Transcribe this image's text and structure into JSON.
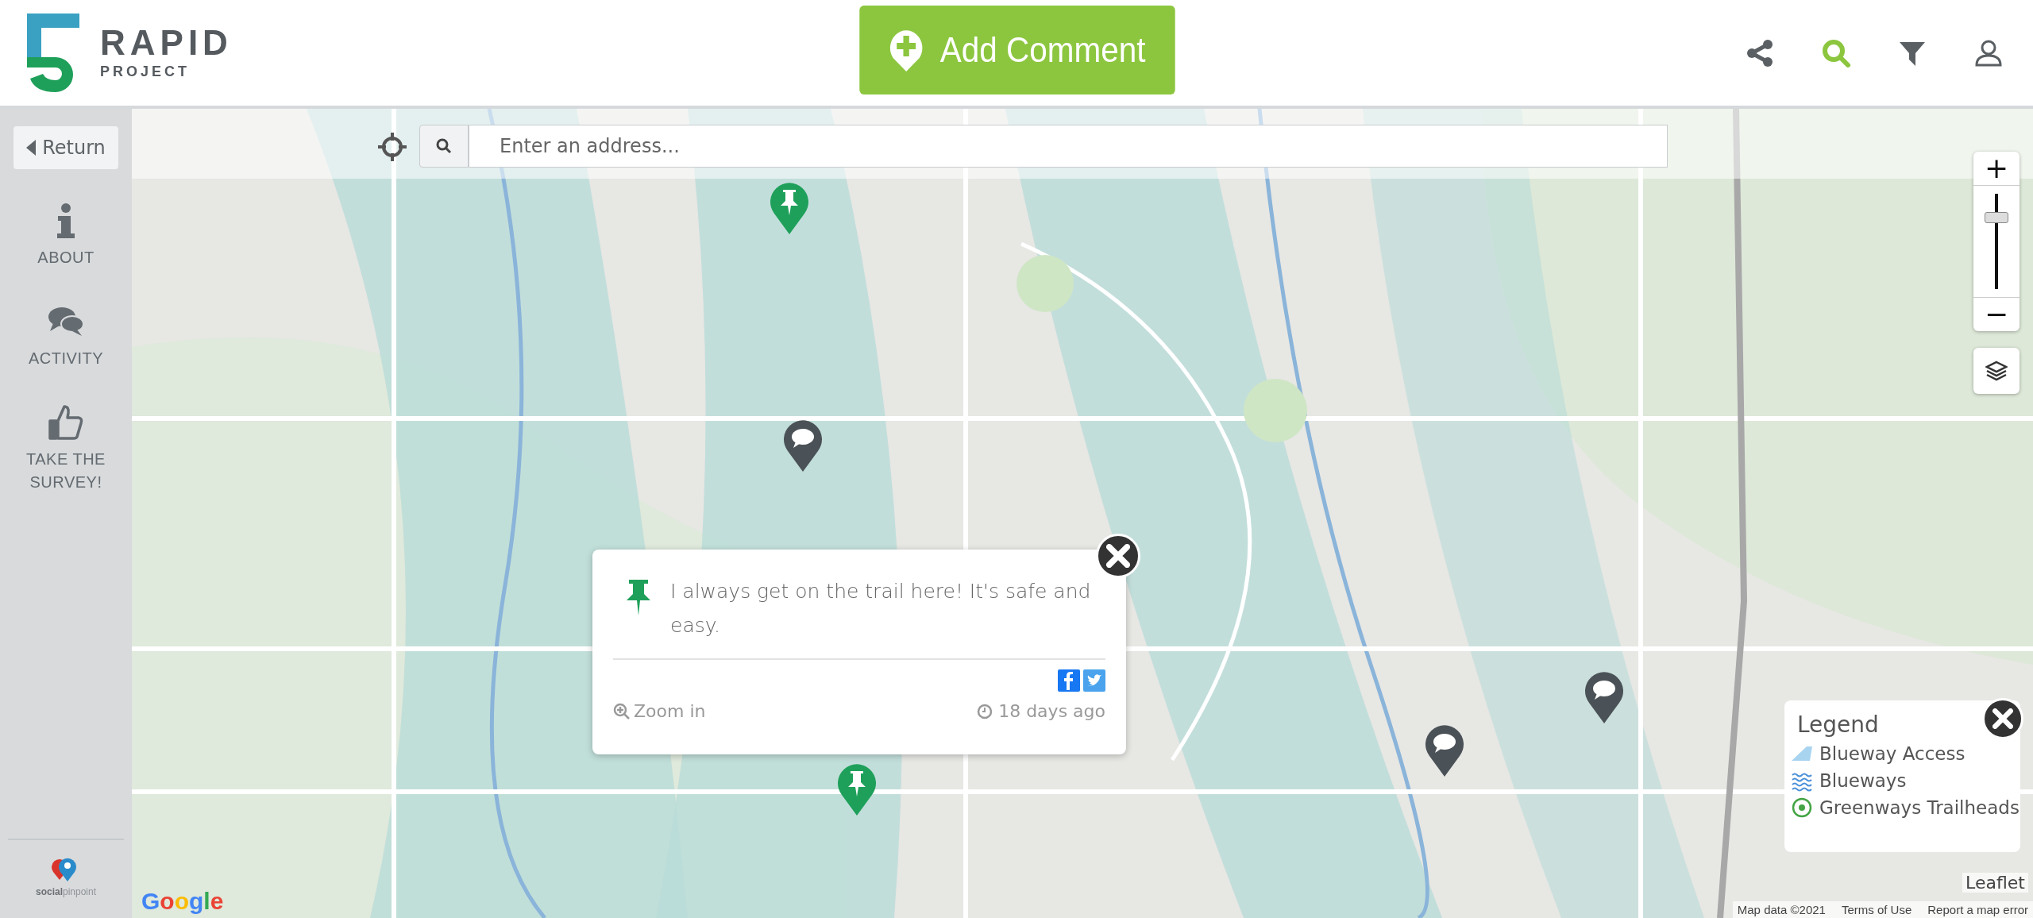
{
  "header": {
    "logo": {
      "title": "RAPID",
      "subtitle": "PROJECT"
    },
    "add_comment_button": "Add Comment",
    "toolbar": [
      {
        "kind": "share",
        "selected": false
      },
      {
        "kind": "search",
        "selected": true
      },
      {
        "kind": "filter",
        "selected": false
      },
      {
        "kind": "user",
        "selected": false
      }
    ]
  },
  "sidebar": {
    "return_button": "Return",
    "items": [
      {
        "kind": "info",
        "label": "ABOUT"
      },
      {
        "kind": "chat",
        "label": "ACTIVITY"
      },
      {
        "kind": "thumb",
        "label": "TAKE THE SURVEY!"
      }
    ],
    "footer_logo": {
      "bold": "social",
      "light": "pinpoint"
    }
  },
  "map": {
    "search": {
      "placeholder": "Enter an address..."
    },
    "markers": [
      {
        "kind": "pin"
      },
      {
        "kind": "comment"
      },
      {
        "kind": "comment"
      },
      {
        "kind": "comment"
      },
      {
        "kind": "pin"
      }
    ],
    "popup": {
      "text": "I always get on the trail here! It's safe and easy.",
      "zoom_link": "Zoom in",
      "time": "18 days ago"
    },
    "zoom": {
      "plus": "+",
      "minus": "−",
      "level": 0.75
    },
    "legend": {
      "title": "Legend",
      "items": [
        {
          "kind": "access",
          "label": "Blueway Access"
        },
        {
          "kind": "waves",
          "label": "Blueways"
        },
        {
          "kind": "trailhead",
          "label": "Greenways Trailheads"
        }
      ]
    },
    "google_logo": "Google",
    "attribution": {
      "leaflet": "Leaflet",
      "map_data": "Map data ©2021",
      "terms": "Terms of Use",
      "report": "Report a map error"
    }
  }
}
